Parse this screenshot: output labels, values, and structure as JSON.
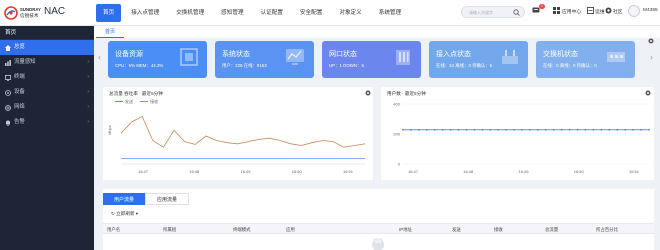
{
  "brand": {
    "logo_en": "SUNDRAY",
    "logo_cn": "信锐技术",
    "name": "NAC"
  },
  "nav": {
    "items": [
      "首页",
      "接入点管理",
      "交换机管理",
      "感知管理",
      "认证配置",
      "安全配置",
      "对象定义",
      "系统管理"
    ],
    "active_index": 0
  },
  "header": {
    "search_placeholder": "请输入关键字",
    "notify_badge": "1",
    "app_center": "应用中心",
    "maintenance": "运维",
    "community": "社区",
    "user": "M4365"
  },
  "sidebar": {
    "title": "首页",
    "items": [
      {
        "label": "总览",
        "icon": "home-icon",
        "active": true
      },
      {
        "label": "流量感知",
        "icon": "traffic-icon",
        "active": false
      },
      {
        "label": "终端",
        "icon": "terminal-icon",
        "active": false
      },
      {
        "label": "设备",
        "icon": "device-icon",
        "active": false
      },
      {
        "label": "网络",
        "icon": "network-icon",
        "active": false
      },
      {
        "label": "告警",
        "icon": "alarm-icon",
        "active": false
      }
    ]
  },
  "page_tab": "首页",
  "cards": [
    {
      "title": "设备资源",
      "stats": "CPU：5%    MEM：44.3%",
      "color": "#4a8ef6"
    },
    {
      "title": "系统状态",
      "stats": "用户：228    在线：9163",
      "color": "#5a93f2"
    },
    {
      "title": "网口状态",
      "stats": "UP：1    DOWN：5",
      "color": "#6b86ec"
    },
    {
      "title": "接入点状态",
      "stats": "在线：34    离线：0    待确认：5",
      "color": "#72a7ec"
    },
    {
      "title": "交换机状态",
      "stats": "在线：0    离线：0    待确认：0",
      "color": "#82b0ef"
    }
  ],
  "traffic_panel": {
    "title": "总流量 吞吐率 · 最近5分钟",
    "legend": [
      "发送",
      "接收"
    ],
    "unit": "Mbps"
  },
  "users_panel": {
    "title": "用户数 · 最近5分钟"
  },
  "chart_data": [
    {
      "type": "line",
      "title": "总流量 吞吐率 · 最近5分钟",
      "ylabel": "Mbps",
      "x_ticks": [
        "16:47",
        "16:48",
        "16:49",
        "16:50",
        "16:51"
      ],
      "series": [
        {
          "name": "发送",
          "color": "#5b8ff9",
          "values": [
            0.1,
            0.1,
            0.1,
            0.1,
            0.1,
            0.1,
            0.1,
            0.1,
            0.1,
            0.1,
            0.1,
            0.1,
            0.1,
            0.1,
            0.1,
            0.1,
            0.1,
            0.1,
            0.1,
            0.1,
            0.1,
            0.1,
            0.1,
            0.1
          ]
        },
        {
          "name": "接收",
          "color": "#c9885a",
          "values": [
            0.55,
            0.75,
            0.85,
            0.42,
            0.3,
            0.6,
            0.4,
            0.35,
            0.5,
            0.42,
            0.38,
            0.36,
            0.4,
            0.44,
            0.46,
            0.42,
            0.36,
            0.33,
            0.38,
            0.42,
            0.4,
            0.3,
            0.33,
            0.36
          ]
        }
      ],
      "ylim": [
        0,
        1
      ]
    },
    {
      "type": "line",
      "title": "用户数 · 最近5分钟",
      "x_ticks": [
        "16:47",
        "16:48",
        "16:49",
        "16:50",
        "16:51"
      ],
      "y_ticks": [
        "0",
        "200",
        "400"
      ],
      "ylim": [
        0,
        400
      ],
      "series": [
        {
          "color": "#5b7be8",
          "values": [
            228,
            228,
            228,
            228,
            228,
            228,
            228,
            228,
            228,
            228,
            228,
            228,
            228,
            228,
            228,
            228,
            228,
            228,
            228,
            228,
            228,
            228,
            228,
            228,
            228,
            228,
            228,
            228,
            228,
            228,
            228,
            228
          ]
        }
      ]
    }
  ],
  "bottom": {
    "tabs": [
      "用户流量",
      "应用流量"
    ],
    "active_tab": 0,
    "refresh_label": "立即刷新",
    "columns": [
      "用户名",
      "所属组",
      "终端模式",
      "应用",
      "IP地址",
      "发送",
      "接收",
      "总流量",
      "所占百分比"
    ]
  }
}
